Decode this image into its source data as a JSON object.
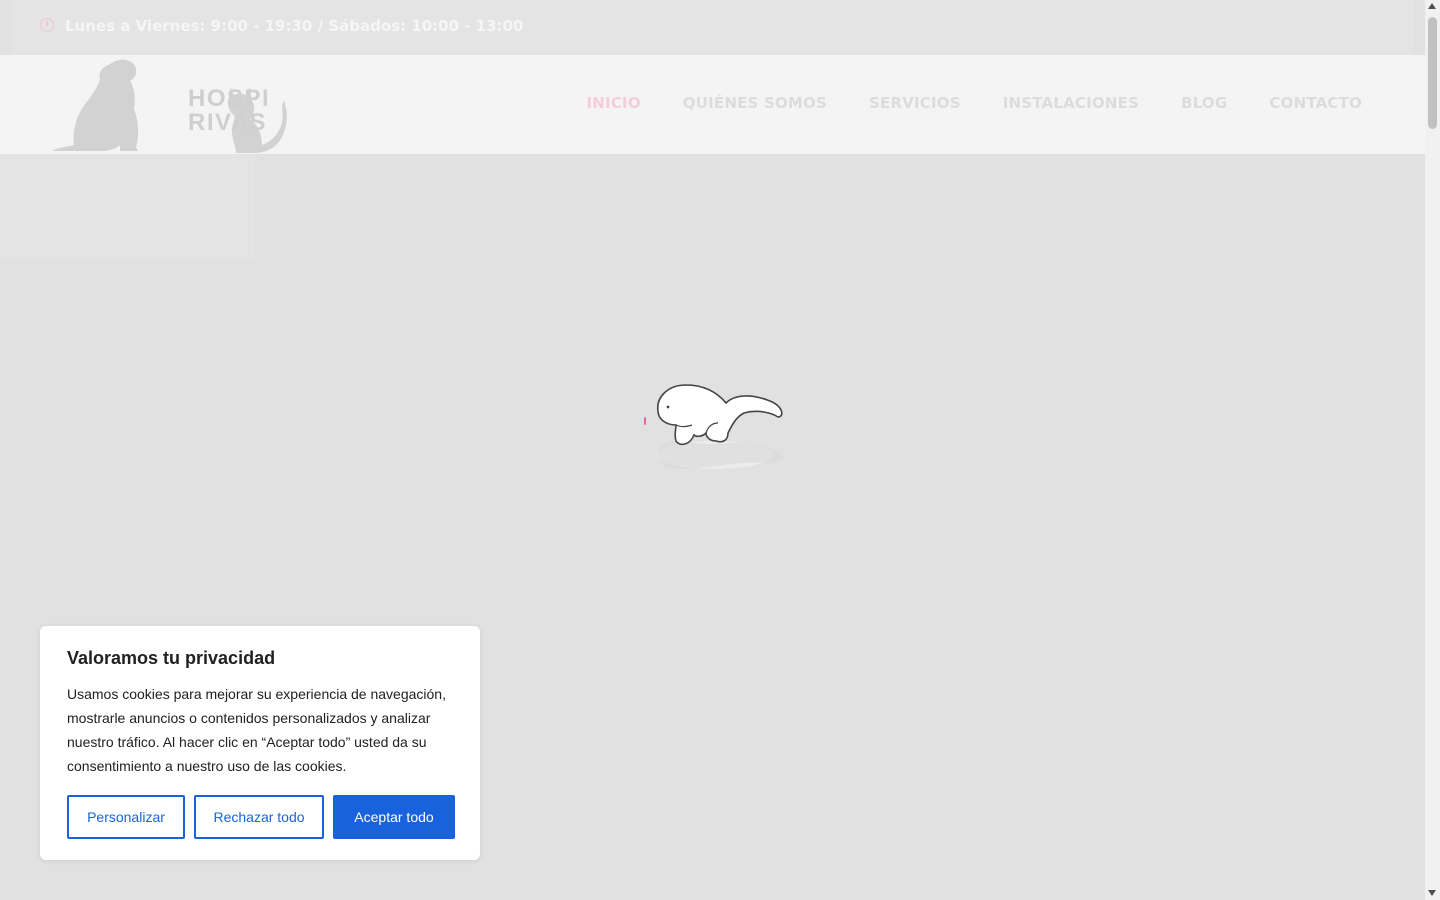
{
  "topbar": {
    "hours": "Lunes a Viernes: 9:00 - 19:30 / Sábados: 10:00 - 13:00",
    "icon": "clock-icon"
  },
  "header": {
    "logo": {
      "text_top": "HOSPI",
      "text_bottom": "RIVAS"
    },
    "nav": [
      {
        "label": "INICIO",
        "active": true
      },
      {
        "label": "QUIÉNES SOMOS"
      },
      {
        "label": "SERVICIOS"
      },
      {
        "label": "INSTALACIONES"
      },
      {
        "label": "BLOG"
      },
      {
        "label": "CONTACTO"
      }
    ]
  },
  "loader": {
    "icon": "cat-loader-icon"
  },
  "cookie_banner": {
    "title": "Valoramos tu privacidad",
    "text": "Usamos cookies para mejorar su experiencia de navegación, mostrarle anuncios o contenidos personalizados y analizar nuestro tráfico. Al hacer clic en “Aceptar todo” usted da su consentimiento a nuestro uso de las cookies.",
    "customize_label": "Personalizar",
    "reject_label": "Rechazar todo",
    "accept_label": "Aceptar todo"
  },
  "colors": {
    "accent_blue": "#1863dc",
    "nav_active_pink": "#f4cdd8",
    "overlay_grey": "#e1e1e1"
  }
}
